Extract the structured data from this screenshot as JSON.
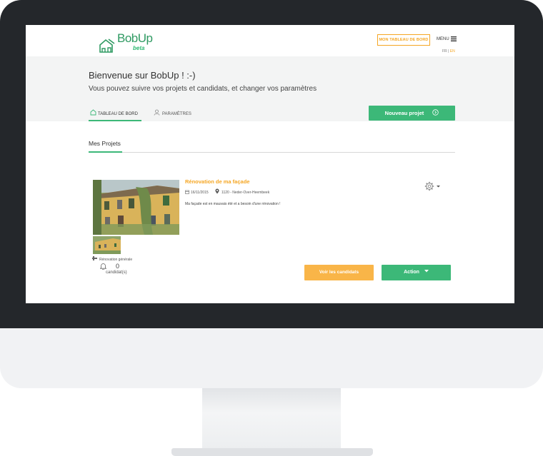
{
  "header": {
    "logo_text": "BobUp",
    "logo_badge": "beta",
    "dashboard_button": "MON TABLEAU DE BORD",
    "menu_label": "MENU",
    "lang_fr": "FR",
    "lang_sep": "|",
    "lang_en": "EN"
  },
  "hero": {
    "welcome": "Bienvenue sur BobUp ! :-)",
    "subtitle": "Vous pouvez suivre vos projets et candidats, et changer vos paramètres",
    "tabs": [
      {
        "label": "TABLEAU DE BORD",
        "active": true
      },
      {
        "label": "PARAMÈTRES",
        "active": false
      }
    ],
    "new_project_button": "Nouveau projet"
  },
  "projects": {
    "section_title": "Mes Projets",
    "items": [
      {
        "title": "Rénovation de ma façade",
        "date": "16/11/2015",
        "location": "1120 - Neder-Over-Heembeek",
        "description": "Ma façade est en mauvais été et a besoin d'une rénovation !",
        "category": "Rénovation générale",
        "candidate_count": "0",
        "candidate_label": "candidat(s)",
        "see_candidates_button": "Voir les candidats",
        "action_button": "Action"
      }
    ]
  },
  "colors": {
    "accent_green": "#3cb878",
    "accent_orange": "#f5a623",
    "hero_bg": "#f3f4f4",
    "bezel": "#24272b"
  }
}
